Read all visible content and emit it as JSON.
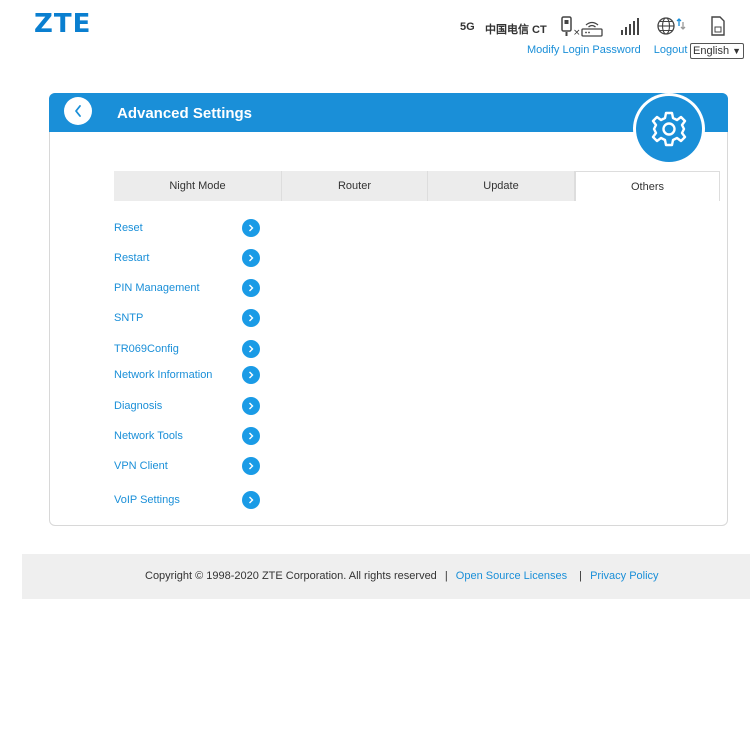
{
  "header": {
    "logo": "ZTE",
    "network_type": "5G",
    "carrier": "中国电信 CT",
    "icons": [
      "sim-disconnected-icon",
      "router-icon",
      "signal-bars-icon",
      "globe-data-icon",
      "sim-card-icon"
    ]
  },
  "links": {
    "modify_password": "Modify Login Password",
    "logout": "Logout"
  },
  "language": {
    "selected": "English"
  },
  "card": {
    "title": "Advanced Settings",
    "tabs": [
      {
        "label": "Night Mode"
      },
      {
        "label": "Router"
      },
      {
        "label": "Update"
      },
      {
        "label": "Others",
        "active": true
      }
    ],
    "menu": [
      {
        "label": "Reset"
      },
      {
        "label": "Restart"
      },
      {
        "label": "PIN Management"
      },
      {
        "label": "SNTP"
      },
      {
        "label": "TR069Config"
      },
      {
        "label": "Network Information"
      },
      {
        "label": "Diagnosis"
      },
      {
        "label": "Network Tools"
      },
      {
        "label": "VPN Client"
      },
      {
        "label": "VoIP Settings"
      }
    ]
  },
  "footer": {
    "copyright": "Copyright © 1998-2020 ZTE Corporation. All rights reserved",
    "sep": "|",
    "open_source": "Open Source Licenses",
    "privacy": "Privacy Policy"
  },
  "colors": {
    "accent": "#1a8fd8",
    "footer_bg": "#efefef"
  }
}
